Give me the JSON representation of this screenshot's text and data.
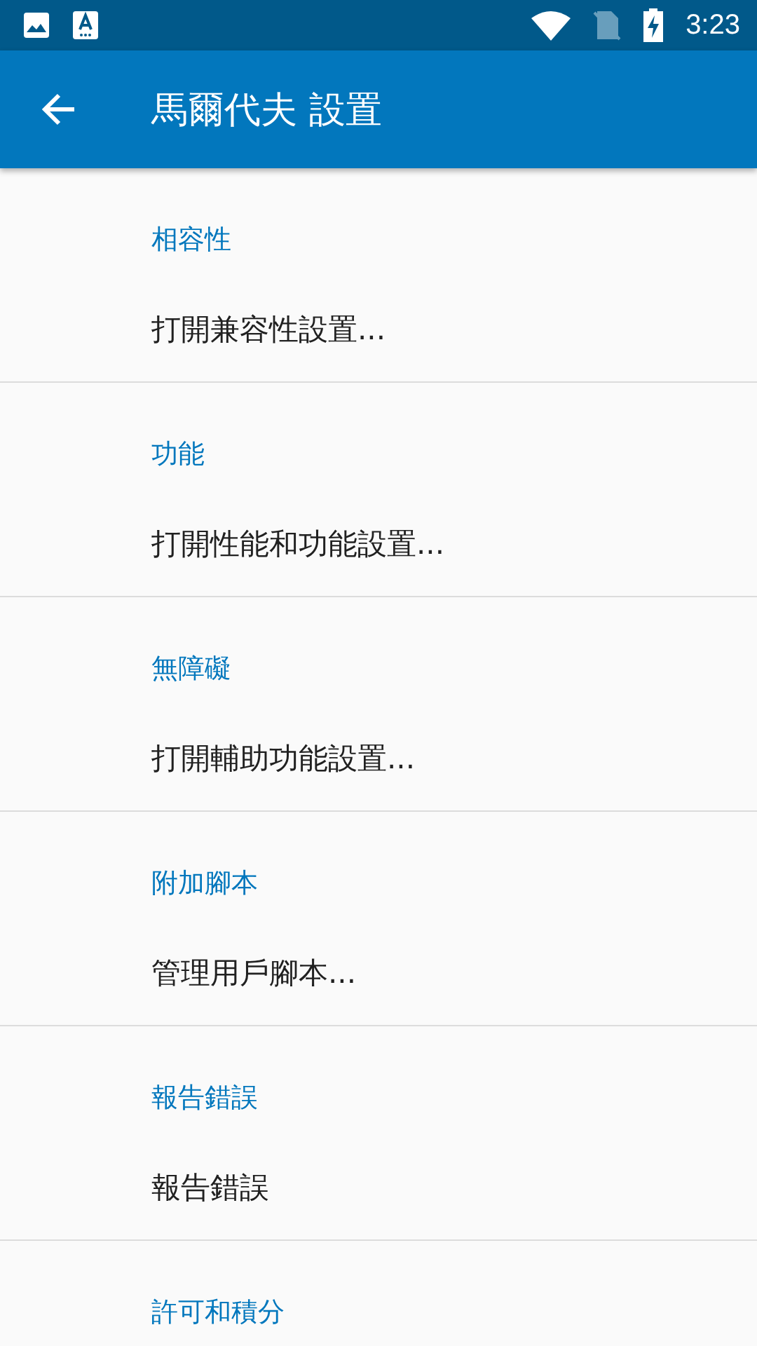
{
  "status_bar": {
    "time": "3:23"
  },
  "app_bar": {
    "title": "馬爾代夫 設置"
  },
  "sections": [
    {
      "header": "相容性",
      "items": [
        "打開兼容性設置..."
      ]
    },
    {
      "header": "功能",
      "items": [
        "打開性能和功能設置..."
      ]
    },
    {
      "header": "無障礙",
      "items": [
        "打開輔助功能設置..."
      ]
    },
    {
      "header": "附加腳本",
      "items": [
        "管理用戶腳本..."
      ]
    },
    {
      "header": "報告錯誤",
      "items": [
        "報告錯誤"
      ]
    },
    {
      "header": "許可和積分"
    }
  ]
}
